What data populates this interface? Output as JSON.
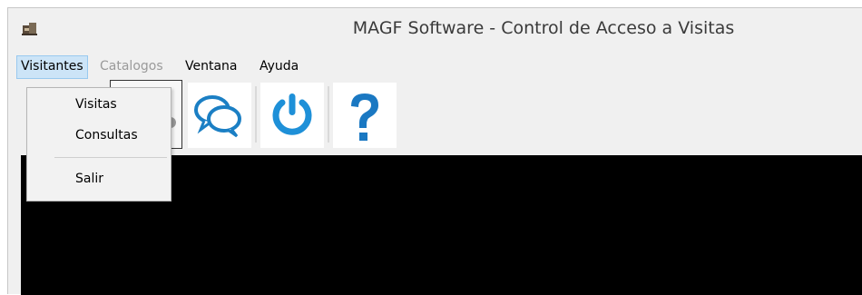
{
  "window": {
    "title": "MAGF Software - Control de Acceso a Visitas",
    "icon": "app-logo-icon"
  },
  "menubar": {
    "items": [
      {
        "label": "Visitantes",
        "state": "open"
      },
      {
        "label": "Catalogos",
        "state": "disabled"
      },
      {
        "label": "Ventana",
        "state": "normal"
      },
      {
        "label": "Ayuda",
        "state": "normal"
      }
    ]
  },
  "dropdown": {
    "items": [
      {
        "label": "Visitas"
      },
      {
        "label": "Consultas"
      },
      {
        "label": "Salir"
      }
    ]
  },
  "toolbar": {
    "buttons": [
      {
        "icon": "chat-bubbles-icon"
      },
      {
        "icon": "power-icon"
      },
      {
        "icon": "help-question-icon"
      }
    ]
  },
  "colors": {
    "menu_highlight": "#cce4f7",
    "menu_highlight_border": "#99c9ef",
    "power_blue": "#1e90d8",
    "help_blue": "#1a78c2",
    "workspace": "#000000"
  }
}
